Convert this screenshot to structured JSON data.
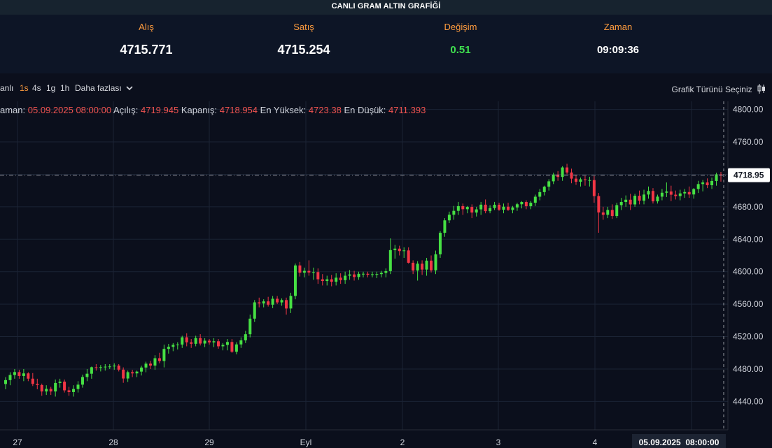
{
  "title": "CANLI GRAM ALTIN GRAFİĞİ",
  "quotes": {
    "alis_label": "Alış",
    "alis_value": "4715.771",
    "satis_label": "Satış",
    "satis_value": "4715.254",
    "degisim_label": "Değişim",
    "degisim_value": "0.51",
    "zaman_label": "Zaman",
    "zaman_value": "09:09:36"
  },
  "toolbar": {
    "canli": "anlı",
    "timeframes": [
      "1s",
      "4s",
      "1g",
      "1h"
    ],
    "active_timeframe": "1s",
    "more": "Daha fazlası",
    "chart_type": "Grafik Türünü Seçiniz"
  },
  "legend": {
    "time_label": "aman:",
    "time_value": "05.09.2025 08:00:00",
    "open_label": "Açılış:",
    "open_value": "4719.945",
    "close_label": "Kapanış:",
    "close_value": "4718.954",
    "high_label": "En Yüksek:",
    "high_value": "4723.38",
    "low_label": "En Düşük:",
    "low_value": "4711.393"
  },
  "colors": {
    "up": "#46e043",
    "down": "#f23645",
    "background": "#0b0f1c",
    "grid": "#1b2334",
    "accent": "#ff9c3e",
    "crosshair": "#9598a1"
  },
  "chart_data": {
    "type": "candlestick",
    "title": "CANLI GRAM ALTIN GRAFİĞİ",
    "interval": "1s",
    "ylim": [
      4405,
      4810
    ],
    "y_ticks": [
      4440,
      4480,
      4520,
      4560,
      4600,
      4640,
      4680,
      4720,
      4760,
      4800
    ],
    "y_tick_labels": [
      "4440.00",
      "4480.00",
      "4520.00",
      "4560.00",
      "4600.00",
      "4640.00",
      "4680.00",
      "4720.00",
      "4760.00",
      "4800.00"
    ],
    "x_tick_labels": [
      "27",
      "28",
      "29",
      "Eyl",
      "2",
      "3",
      "4"
    ],
    "last_price_label": "4718.95",
    "crosshair_time_label": "05.09.2025  08:00:00",
    "grid": true,
    "candles": [
      [
        4461.5,
        4470,
        4455,
        4466.3
      ],
      [
        4466.3,
        4476,
        4460,
        4472.6
      ],
      [
        4472.6,
        4480,
        4468,
        4476.2
      ],
      [
        4476.2,
        4479,
        4468,
        4471.4
      ],
      [
        4471.4,
        4480,
        4465,
        4474.6
      ],
      [
        4474.6,
        4476,
        4465,
        4468.1
      ],
      [
        4468.1,
        4475,
        4459,
        4461.6
      ],
      [
        4461.6,
        4468,
        4455,
        4460.2
      ],
      [
        4460.2,
        4462,
        4447,
        4452.3
      ],
      [
        4452.3,
        4460,
        4448,
        4455.5
      ],
      [
        4455.5,
        4458,
        4448,
        4452.3
      ],
      [
        4452.3,
        4467,
        4446,
        4462.8
      ],
      [
        4462.8,
        4468,
        4457,
        4464.4
      ],
      [
        4464.4,
        4467,
        4451,
        4453.7
      ],
      [
        4453.7,
        4458,
        4447,
        4451.6
      ],
      [
        4451.6,
        4460,
        4446,
        4455.3
      ],
      [
        4455.3,
        4465,
        4451,
        4460.7
      ],
      [
        4460.7,
        4473,
        4457,
        4470.1
      ],
      [
        4470.1,
        4480,
        4465,
        4474.2
      ],
      [
        4474.2,
        4483,
        4468,
        4482.2
      ],
      [
        4482.2,
        4486,
        4478,
        4481.8
      ],
      [
        4481.8,
        4485,
        4477,
        4482.4
      ],
      [
        4482.4,
        4486,
        4478,
        4482.9
      ],
      [
        4482.9,
        4486,
        4480,
        4483.2
      ],
      [
        4483.2,
        4487,
        4479,
        4484.1
      ],
      [
        4484.1,
        4486,
        4477,
        4479.2
      ],
      [
        4479.2,
        4482,
        4463,
        4468.3
      ],
      [
        4468.3,
        4478,
        4464,
        4476.1
      ],
      [
        4476.1,
        4479,
        4470,
        4474.6
      ],
      [
        4474.6,
        4478,
        4470,
        4476.8
      ],
      [
        4476.8,
        4484,
        4472,
        4481.8
      ],
      [
        4481.8,
        4489,
        4476,
        4486.6
      ],
      [
        4486.6,
        4490,
        4480,
        4484.2
      ],
      [
        4484.2,
        4497,
        4479,
        4493.3
      ],
      [
        4493.3,
        4500,
        4487,
        4489.8
      ],
      [
        4489.8,
        4510,
        4482,
        4504.8
      ],
      [
        4504.8,
        4511,
        4499,
        4507.3
      ],
      [
        4507.3,
        4512,
        4502,
        4509.8
      ],
      [
        4509.8,
        4513,
        4504,
        4510.1
      ],
      [
        4510.1,
        4521,
        4506,
        4519.1
      ],
      [
        4519.1,
        4524,
        4508,
        4512.9
      ],
      [
        4512.9,
        4517,
        4506,
        4511.1
      ],
      [
        4511.1,
        4521,
        4508,
        4518.1
      ],
      [
        4518.1,
        4523,
        4509,
        4511.4
      ],
      [
        4511.4,
        4518,
        4507,
        4514.9
      ],
      [
        4514.9,
        4517,
        4510,
        4512.8
      ],
      [
        4512.8,
        4518,
        4507,
        4514.2
      ],
      [
        4514.2,
        4517,
        4505,
        4508.0
      ],
      [
        4508.0,
        4512,
        4503,
        4509.7
      ],
      [
        4509.7,
        4517,
        4503,
        4513.3
      ],
      [
        4513.3,
        4517,
        4500,
        4501.2
      ],
      [
        4501.2,
        4513,
        4498,
        4510.3
      ],
      [
        4510.3,
        4519,
        4506,
        4515.3
      ],
      [
        4515.3,
        4527,
        4512,
        4522.9
      ],
      [
        4522.9,
        4547,
        4519,
        4542.1
      ],
      [
        4542.1,
        4565,
        4538,
        4562.2
      ],
      [
        4562.2,
        4568,
        4556,
        4560.8
      ],
      [
        4560.8,
        4566,
        4556,
        4563.4
      ],
      [
        4563.4,
        4569,
        4557,
        4559.3
      ],
      [
        4559.3,
        4570,
        4555,
        4566.6
      ],
      [
        4566.6,
        4570,
        4560,
        4562.1
      ],
      [
        4562.1,
        4567,
        4558,
        4565.0
      ],
      [
        4565.0,
        4568,
        4547,
        4554.6
      ],
      [
        4554.6,
        4574,
        4549,
        4570.1
      ],
      [
        4570.1,
        4610,
        4566,
        4607.7
      ],
      [
        4607.7,
        4612,
        4594,
        4598.8
      ],
      [
        4598.8,
        4605,
        4593,
        4601.0
      ],
      [
        4601.0,
        4614,
        4595,
        4599.0
      ],
      [
        4599.0,
        4605,
        4590,
        4599.5
      ],
      [
        4599.5,
        4604,
        4585,
        4590.6
      ],
      [
        4590.6,
        4597,
        4583,
        4588.5
      ],
      [
        4588.5,
        4595,
        4583,
        4590.6
      ],
      [
        4590.6,
        4596,
        4582,
        4587.6
      ],
      [
        4587.6,
        4598,
        4583,
        4592.6
      ],
      [
        4592.6,
        4598,
        4585,
        4589.5
      ],
      [
        4589.5,
        4600,
        4585,
        4595.0
      ],
      [
        4595.0,
        4602,
        4590,
        4596.6
      ],
      [
        4596.6,
        4601,
        4589,
        4593.4
      ],
      [
        4593.4,
        4600,
        4590,
        4597.3
      ],
      [
        4597.3,
        4600,
        4593,
        4597.4
      ],
      [
        4597.4,
        4600,
        4593,
        4596.2
      ],
      [
        4596.2,
        4600,
        4593,
        4596.8
      ],
      [
        4596.8,
        4600,
        4592,
        4597.0
      ],
      [
        4597.0,
        4601,
        4593,
        4598.5
      ],
      [
        4598.5,
        4604,
        4593,
        4600.7
      ],
      [
        4600.7,
        4641,
        4597,
        4626.6
      ],
      [
        4626.6,
        4633,
        4616,
        4628.4
      ],
      [
        4628.4,
        4632,
        4620,
        4625.4
      ],
      [
        4625.4,
        4630,
        4617,
        4626.2
      ],
      [
        4626.2,
        4630,
        4610,
        4611.0
      ],
      [
        4611.0,
        4614,
        4597,
        4601.4
      ],
      [
        4601.4,
        4613,
        4589,
        4609.8
      ],
      [
        4609.8,
        4614,
        4596,
        4602.6
      ],
      [
        4602.6,
        4617,
        4595,
        4613.6
      ],
      [
        4613.6,
        4620,
        4599,
        4601.6
      ],
      [
        4601.6,
        4626,
        4597,
        4621.4
      ],
      [
        4621.4,
        4650,
        4617,
        4647.9
      ],
      [
        4647.9,
        4666,
        4643,
        4663.3
      ],
      [
        4663.3,
        4674,
        4660,
        4670.2
      ],
      [
        4670.2,
        4681,
        4664,
        4675.0
      ],
      [
        4675.0,
        4686,
        4670,
        4680.8
      ],
      [
        4680.8,
        4684,
        4670,
        4677.0
      ],
      [
        4677.0,
        4681,
        4672,
        4679.8
      ],
      [
        4679.8,
        4683,
        4666,
        4672.9
      ],
      [
        4672.9,
        4680,
        4668,
        4676.8
      ],
      [
        4676.8,
        4686,
        4670,
        4682.6
      ],
      [
        4682.6,
        4689,
        4672,
        4674.6
      ],
      [
        4674.6,
        4682,
        4672,
        4678.4
      ],
      [
        4678.4,
        4686,
        4676,
        4682.5
      ],
      [
        4682.5,
        4685,
        4675,
        4676.4
      ],
      [
        4676.4,
        4684,
        4672,
        4680.1
      ],
      [
        4680.1,
        4685,
        4675,
        4676.1
      ],
      [
        4676.1,
        4681,
        4672,
        4679.2
      ],
      [
        4679.2,
        4685,
        4675,
        4683.1
      ],
      [
        4683.1,
        4687,
        4678,
        4685.9
      ],
      [
        4685.9,
        4688,
        4677,
        4680.7
      ],
      [
        4680.7,
        4687,
        4677,
        4685.0
      ],
      [
        4685.0,
        4695,
        4681,
        4692.4
      ],
      [
        4692.4,
        4702,
        4688,
        4698.1
      ],
      [
        4698.1,
        4706,
        4694,
        4704.8
      ],
      [
        4704.8,
        4714,
        4700,
        4711.4
      ],
      [
        4711.4,
        4722,
        4708,
        4719.7
      ],
      [
        4719.7,
        4724,
        4712,
        4716.8
      ],
      [
        4716.8,
        4730,
        4712,
        4728.5
      ],
      [
        4728.5,
        4733,
        4720,
        4722.3
      ],
      [
        4722.3,
        4727,
        4709,
        4714.7
      ],
      [
        4714.7,
        4719,
        4707,
        4710.9
      ],
      [
        4710.9,
        4716,
        4705,
        4713.9
      ],
      [
        4713.9,
        4718,
        4706,
        4712.9
      ],
      [
        4712.9,
        4717,
        4705,
        4712.9
      ],
      [
        4712.9,
        4718,
        4685,
        4693.2
      ],
      [
        4693.2,
        4697,
        4648,
        4673.0
      ],
      [
        4673.0,
        4680,
        4664,
        4670.1
      ],
      [
        4670.1,
        4680,
        4666,
        4676.1
      ],
      [
        4676.1,
        4683,
        4665,
        4668.6
      ],
      [
        4668.6,
        4685,
        4666,
        4682.0
      ],
      [
        4682.0,
        4691,
        4676,
        4685.9
      ],
      [
        4685.9,
        4694,
        4680,
        4688.7
      ],
      [
        4688.7,
        4696,
        4676,
        4682.9
      ],
      [
        4682.9,
        4696,
        4680,
        4693.6
      ],
      [
        4693.6,
        4700,
        4683,
        4687.5
      ],
      [
        4687.5,
        4701,
        4683,
        4695.1
      ],
      [
        4695.1,
        4705,
        4690,
        4699.5
      ],
      [
        4699.5,
        4703,
        4684,
        4686.7
      ],
      [
        4686.7,
        4695,
        4684,
        4692.5
      ],
      [
        4692.5,
        4702,
        4688,
        4697.3
      ],
      [
        4697.3,
        4710,
        4692,
        4698.9
      ],
      [
        4698.9,
        4706,
        4687,
        4694.9
      ],
      [
        4694.9,
        4700,
        4689,
        4693.2
      ],
      [
        4693.2,
        4701,
        4688,
        4696.5
      ],
      [
        4696.5,
        4702,
        4691,
        4698.2
      ],
      [
        4698.2,
        4705,
        4691,
        4695.2
      ],
      [
        4695.2,
        4703,
        4690,
        4701.9
      ],
      [
        4701.9,
        4712,
        4697,
        4708.0
      ],
      [
        4708.0,
        4713,
        4699,
        4710.0
      ],
      [
        4710.0,
        4715,
        4703,
        4706.6
      ],
      [
        4706.6,
        4716,
        4702,
        4711.8
      ],
      [
        4711.8,
        4722,
        4706,
        4719.9
      ],
      [
        4719.9,
        4723,
        4711,
        4718.95
      ]
    ]
  }
}
